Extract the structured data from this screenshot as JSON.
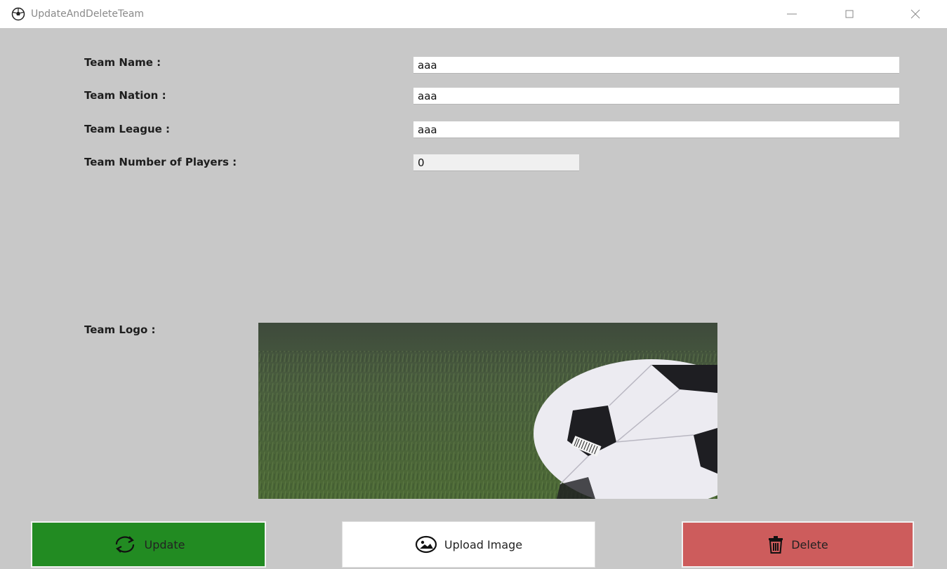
{
  "window": {
    "title": "UpdateAndDeleteTeam",
    "minimize_glyph": "—",
    "maximize_glyph": "☐",
    "close_glyph": "✕"
  },
  "form": {
    "team_name": {
      "label": "Team Name :",
      "value": "aaa"
    },
    "team_nation": {
      "label": "Team Nation :",
      "value": "aaa"
    },
    "team_league": {
      "label": "Team League :",
      "value": "aaa"
    },
    "team_players": {
      "label": "Team Number of Players :",
      "value": "0"
    },
    "team_logo": {
      "label": "Team Logo :"
    }
  },
  "buttons": {
    "update": {
      "label": "Update",
      "color": "#228b22",
      "icon": "refresh-icon"
    },
    "upload": {
      "label": "Upload Image",
      "color": "#ffffff",
      "icon": "image-upload-icon"
    },
    "delete": {
      "label": "Delete",
      "color": "#cd5c5c",
      "icon": "trash-icon"
    }
  },
  "colors": {
    "window_background": "#c8c8c8",
    "field_background": "#ffffff"
  }
}
